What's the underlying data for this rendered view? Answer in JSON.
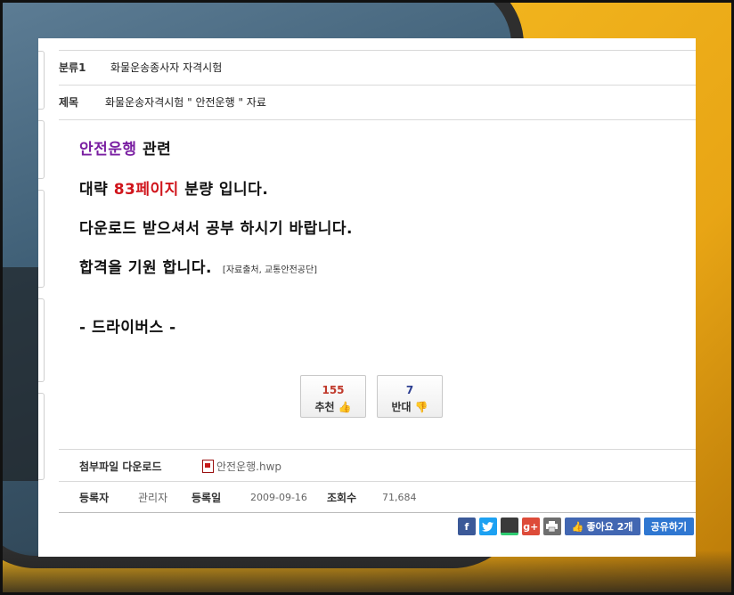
{
  "category": {
    "label": "분류1",
    "value": "화물운송종사자 자격시험"
  },
  "subject": {
    "label": "제목",
    "value": "화물운송자격시험 \" 안전운행 \" 자료"
  },
  "body": {
    "line1_highlight": "안전운행",
    "line1_rest": " 관련",
    "line2_pre": "대략 ",
    "line2_highlight": "83페이지",
    "line2_post": " 분량 입니다.",
    "line3": "다운로드 받으셔서 공부 하시기 바랍니다.",
    "line4": "합격을 기원 합니다.",
    "line4_source": "[자료출처, 교통안전공단]",
    "signature": "- 드라이버스 -"
  },
  "votes": {
    "up": {
      "count": "155",
      "label": "추천",
      "color": "#c0392b"
    },
    "down": {
      "count": "7",
      "label": "반대",
      "color": "#2c3e91"
    }
  },
  "attachment": {
    "label": "첨부파일 다운로드",
    "filename": "안전운행.hwp"
  },
  "meta": {
    "author_label": "등록자",
    "author": "관리자",
    "date_label": "등록일",
    "date": "2009-09-16",
    "views_label": "조회수",
    "views": "71,684"
  },
  "share": {
    "facebook_glyph": "f",
    "google_glyph": "g+",
    "like_label": "좋아요 2개",
    "share_label": "공유하기"
  },
  "icons": [
    "facebook-icon",
    "twitter-icon",
    "kakao-icon",
    "google-plus-icon",
    "print-icon",
    "thumbs-up-icon",
    "thumbs-down-icon",
    "file-icon"
  ]
}
